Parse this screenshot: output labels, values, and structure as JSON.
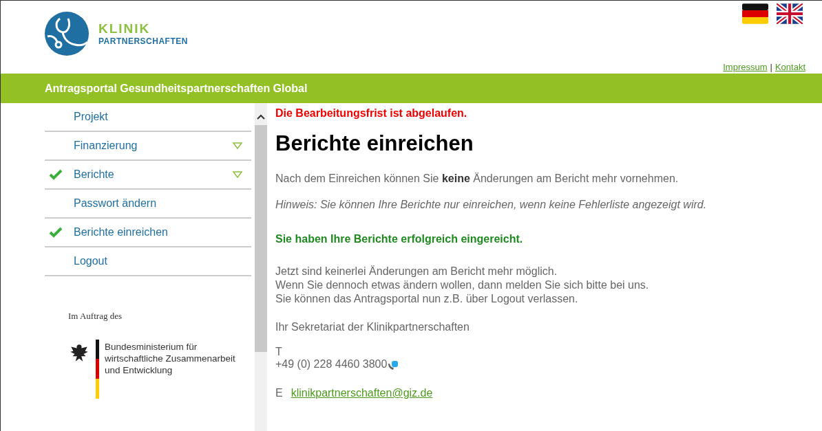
{
  "logo": {
    "line1": "KLINIK",
    "line2": "PARTNERSCHAFTEN"
  },
  "top_links": [
    "Impressum",
    "Kontakt"
  ],
  "top_links_separator": "|",
  "banner": {
    "title": "Antragsportal Gesundheitspartnerschaften Global"
  },
  "sidebar": {
    "items": [
      {
        "label": "Projekt",
        "checked": false,
        "expandable": false
      },
      {
        "label": "Finanzierung",
        "checked": false,
        "expandable": true
      },
      {
        "label": "Berichte",
        "checked": true,
        "expandable": true
      },
      {
        "label": "Passwort ändern",
        "checked": false,
        "expandable": false
      },
      {
        "label": "Berichte einreichen",
        "checked": true,
        "expandable": false
      },
      {
        "label": "Logout",
        "checked": false,
        "expandable": false
      }
    ],
    "sponsor": {
      "caption": "Im Auftrag des",
      "ministry_lines": [
        "Bundesministerium für",
        "wirtschaftliche Zusammenarbeit",
        "und Entwicklung"
      ]
    }
  },
  "content": {
    "deadline_warning": "Die Bearbeitungsfrist ist abgelaufen.",
    "heading": "Berichte einreichen",
    "info": "Nach dem Einreichen können Sie **keine** Änderungen am Bericht mehr vornehmen.",
    "hint": "Hinweis: Sie können Ihre Berichte nur einreichen, wenn keine Fehlerliste angezeigt wird.",
    "success": "Sie haben Ihre Berichte erfolgreich eingereicht.",
    "body_lines": [
      "Jetzt sind keinerlei Änderungen am Bericht mehr möglich.",
      "Wenn Sie dennoch etwas ändern wollen, dann melden Sie sich bitte bei uns.",
      "Sie können das Antragsportal nun z.B. über Logout verlassen."
    ],
    "signature": "Ihr Sekretariat der Klinikpartnerschaften",
    "phone_label": "T",
    "phone": "+49 (0) 228 4460 3800",
    "email_label": "E",
    "email": "klinikpartnerschaften@giz.de"
  }
}
